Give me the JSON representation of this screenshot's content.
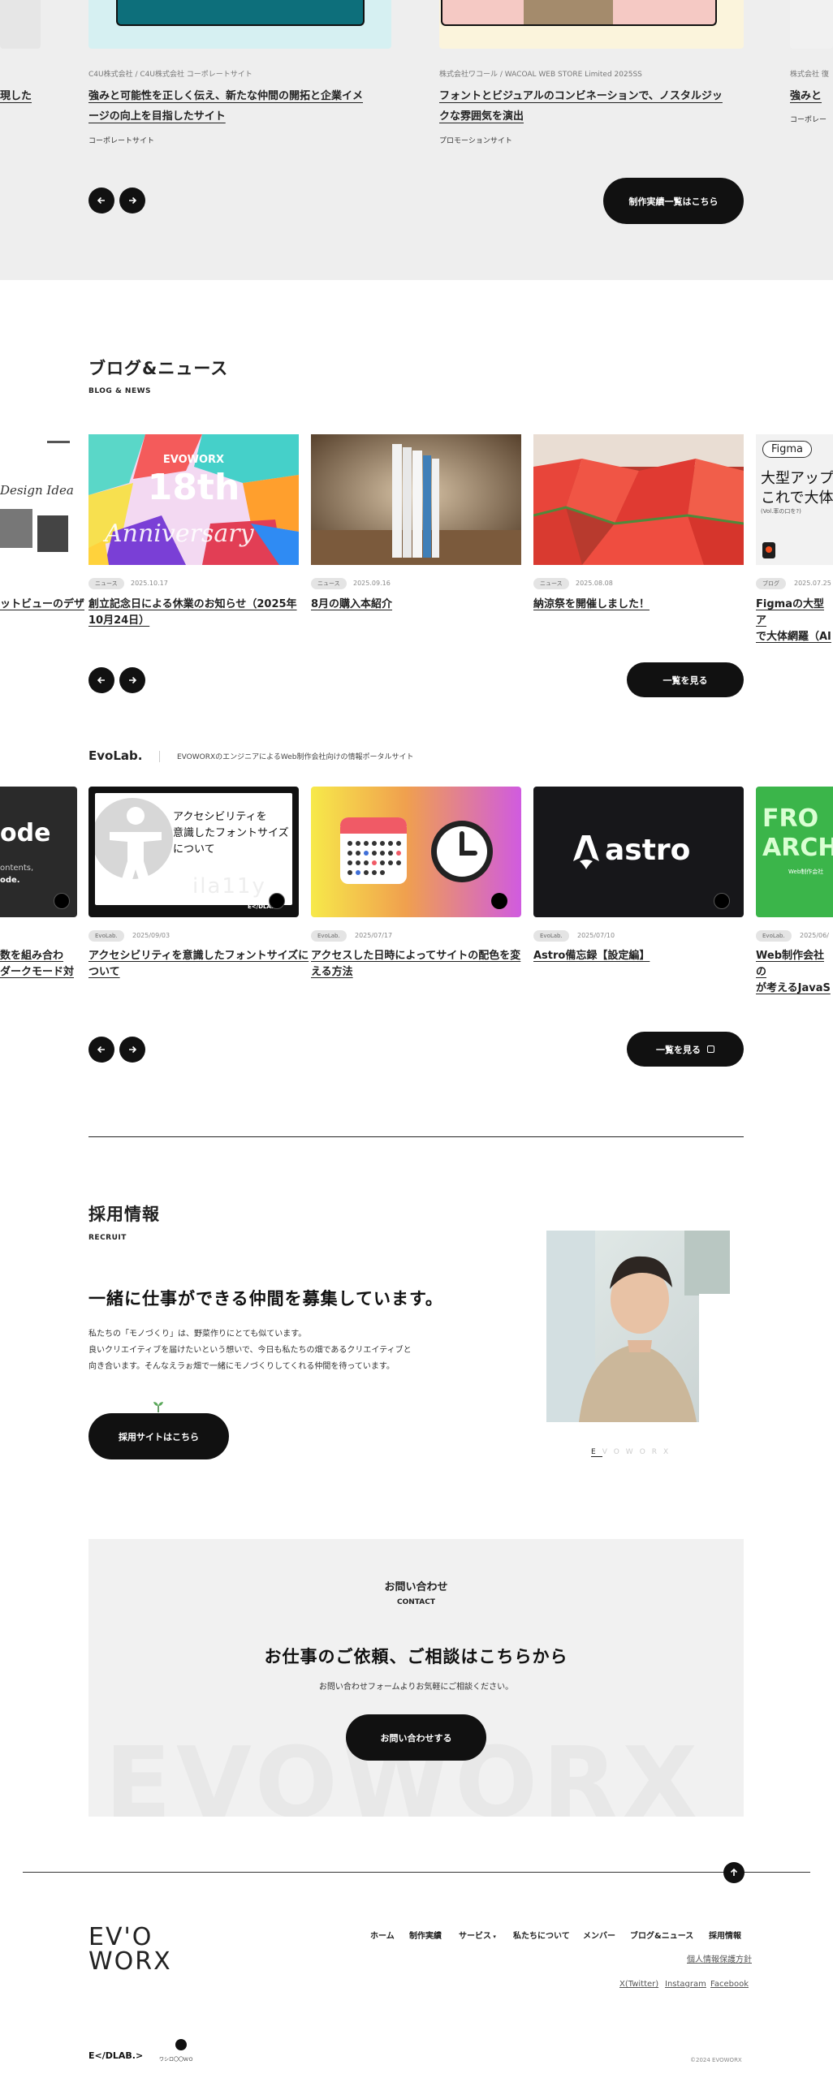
{
  "colors": {
    "dark": "#111111",
    "gray_bg": "#eeeeee",
    "contact_bg": "#f1f1f1"
  },
  "works": {
    "left_partial_title": "現した",
    "items": [
      {
        "meta": "C4U株式会社 / C4U株式会社 コーポレートサイト",
        "title_l1": "強みと可能性を正しく伝え、新たな仲間の開拓と企業イメ",
        "title_l2": "ージの向上を目指したサイト",
        "tag": "コーポレートサイト"
      },
      {
        "meta": "株式会社ワコール / WACOAL WEB STORE Limited 2025SS",
        "title_l1": "フォントとビジュアルのコンビネーションで、ノスタルジッ",
        "title_l2": "クな雰囲気を演出",
        "tag": "プロモーションサイト"
      },
      {
        "meta": "株式会社 復",
        "title_l1": "強みと",
        "tag": "コーポレー"
      }
    ],
    "prev_icon": "arrow-left-icon",
    "next_icon": "arrow-right-icon",
    "all_works_button": "制作実績一覧はこちら"
  },
  "blog": {
    "title": "ブログ&ニュース",
    "subtitle": "BLOG & NEWS",
    "cards": [
      {
        "chip": "",
        "date": "",
        "title_l1": "ットビューのデザ",
        "title_l2": "",
        "img_text": "Design Idea"
      },
      {
        "chip": "ニュース",
        "date": "2025.10.17",
        "title_l1": "創立記念日による休業のお知らせ（2025年",
        "title_l2": "10月24日）",
        "img_brand": "EVOWORX",
        "img_big": "18th",
        "img_script": "Anniversary"
      },
      {
        "chip": "ニュース",
        "date": "2025.09.16",
        "title_l1": "8月の購入本紹介",
        "title_l2": ""
      },
      {
        "chip": "ニュース",
        "date": "2025.08.08",
        "title_l1": "納涼祭を開催しました！",
        "title_l2": ""
      },
      {
        "chip": "ブログ",
        "date": "2025.07.25",
        "title_l1": "Figmaの大型ア",
        "title_l2": "で大体網羅（AI",
        "img_badge": "Figma",
        "img_text1": "大型アップ",
        "img_text2": "これで大体",
        "img_text3": "(Vol.率の口を?)"
      }
    ],
    "view_all": "一覧を見る"
  },
  "evolab": {
    "logo": "EvoLab.",
    "tagline": "EVOWORXのエンジニアによるWeb制作会社向けの情報ポータルサイト",
    "cards": [
      {
        "chip": "",
        "date": "",
        "title_l1": "数を組み合わ",
        "title_l2": "ダークモード対",
        "img_word": "ode",
        "img_small1": "ontents,",
        "img_small2": "ode."
      },
      {
        "chip": "EvoLab.",
        "date": "2025/09/03",
        "title_l1": "アクセシビリティを意識したフォントサイズに",
        "title_l2": "ついて",
        "img_l1": "アクセシビリティを",
        "img_l2": "意識したフォントサイズ",
        "img_l3": "について",
        "img_ghost": "ila11y",
        "img_logo": "E</DLAB."
      },
      {
        "chip": "EvoLab.",
        "date": "2025/07/17",
        "title_l1": "アクセスした日時によってサイトの配色を変",
        "title_l2": "える方法"
      },
      {
        "chip": "EvoLab.",
        "date": "2025/07/10",
        "title_l1": "Astro備忘録【設定編】",
        "title_l2": "",
        "img_word": "astro"
      },
      {
        "chip": "EvoLab.",
        "date": "2025/06/",
        "title_l1": "Web制作会社の",
        "title_l2": "が考えるJavaS",
        "img_l1": "FRO",
        "img_l2": "ARCH",
        "img_small": "Web制作会社"
      }
    ],
    "view_all": "一覧を見る"
  },
  "recruit": {
    "title": "採用情報",
    "subtitle": "RECRUIT",
    "heading": "一緒に仕事ができる仲間を募集しています。",
    "body": [
      "私たちの「モノづくり」は、野菜作りにとても似ています。",
      "良いクリエイティブを届けたいという想いで、今日も私たちの畑であるクリエイティブと",
      "向き合います。そんなえラぉ畑で一緒にモノづくりしてくれる仲間を待っています。"
    ],
    "button": "採用サイトはこちら",
    "logo_letters": [
      "E",
      "V",
      "O",
      "W",
      "O",
      "R",
      "X"
    ]
  },
  "contact": {
    "title": "お問い合わせ",
    "subtitle": "CONTACT",
    "heading": "お仕事のご依頼、ご相談はこちらから",
    "description": "お問い合わせフォームよりお気軽にご相談ください。",
    "button": "お問い合わせする",
    "watermark": "EVOWORX"
  },
  "footer": {
    "logo_l1": "EV'O",
    "logo_l2": "WORX",
    "nav": [
      "ホーム",
      "制作実績",
      "サービス",
      "私たちについて",
      "メンバー",
      "ブログ&ニュース",
      "採用情報"
    ],
    "privacy": "個人情報保護方針",
    "social": [
      "X(Twitter)",
      "Instagram",
      "Facebook"
    ],
    "brand1": "E</DLAB.>",
    "brand2": "ワシロ〇〇ＷＯ",
    "copyright": "©2024 EVOWORX",
    "back_to_top_icon": "arrow-up-icon"
  }
}
